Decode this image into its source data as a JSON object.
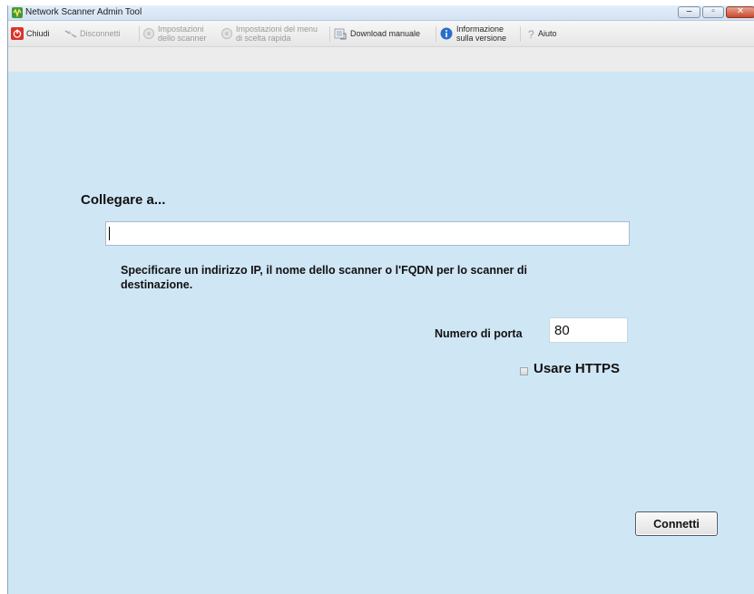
{
  "window": {
    "title": "Network Scanner Admin Tool",
    "controls": {
      "minimize": "‒",
      "maximize": "▫",
      "close": "✕"
    }
  },
  "toolbar": {
    "items": [
      {
        "label": "Chiudi",
        "icon": "power-icon",
        "enabled": true
      },
      {
        "label": "Disconnetti",
        "icon": "disconnect-icon",
        "enabled": false
      },
      {
        "label_line1": "Impostazioni",
        "label_line2": "dello scanner",
        "icon": "gear-icon",
        "enabled": false
      },
      {
        "label_line1": "Impostazioni del menu",
        "label_line2": "di scelta rapida",
        "icon": "gear-icon",
        "enabled": false
      },
      {
        "label": "Download manuale",
        "icon": "download-icon",
        "enabled": true
      },
      {
        "label_line1": "Informazione",
        "label_line2": "sulla versione",
        "icon": "info-icon",
        "enabled": true
      },
      {
        "label": "Aiuto",
        "icon": "help-icon",
        "enabled": true
      }
    ]
  },
  "connect": {
    "heading": "Collegare a...",
    "host_value": "",
    "help_text": "Specificare un indirizzo IP, il nome dello scanner o l'FQDN per lo scanner di destinazione.",
    "port_label": "Numero di porta",
    "port_value": "80",
    "https_label": "Usare HTTPS",
    "https_checked": false,
    "connect_button": "Connetti"
  },
  "colors": {
    "background": "#cfe6f5",
    "toolbar": "#ececec",
    "close_red": "#c9482b"
  }
}
